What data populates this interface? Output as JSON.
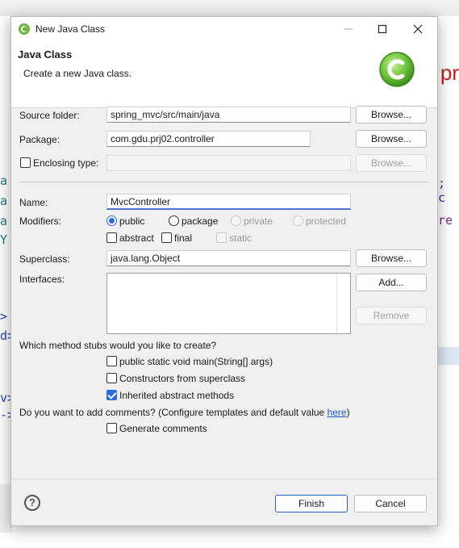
{
  "window": {
    "title": "New Java Class"
  },
  "header": {
    "title": "Java Class",
    "description": "Create a new Java class."
  },
  "form": {
    "source_folder_label": "Source folder:",
    "source_folder_value": "spring_mvc/src/main/java",
    "package_label": "Package:",
    "package_value": "com.gdu.prj02.controller",
    "enclosing_type_label": "Enclosing type:",
    "enclosing_type_value": "",
    "name_label": "Name:",
    "name_value": "MvcController",
    "modifiers_label": "Modifiers:",
    "modifiers": {
      "public": "public",
      "package": "package",
      "private": "private",
      "protected": "protected",
      "abstract": "abstract",
      "final": "final",
      "static": "static"
    },
    "superclass_label": "Superclass:",
    "superclass_value": "java.lang.Object",
    "interfaces_label": "Interfaces:",
    "stubs_question": "Which method stubs would you like to create?",
    "stub_main": "public static void main(String[] args)",
    "stub_constructors": "Constructors from superclass",
    "stub_inherited": "Inherited abstract methods",
    "comments_question_prefix": "Do you want to add comments? (Configure templates and default value ",
    "comments_question_link": "here",
    "comments_question_suffix": ")",
    "generate_comments": "Generate comments"
  },
  "buttons": {
    "browse": "Browse...",
    "add": "Add...",
    "remove": "Remove",
    "finish": "Finish",
    "cancel": "Cancel"
  },
  "state": {
    "modifier_selected": "public",
    "stub_main_checked": false,
    "stub_constructors_checked": false,
    "stub_inherited_checked": true,
    "generate_comments_checked": false,
    "enclosing_type_checked": false,
    "abstract_checked": false,
    "final_checked": false,
    "static_checked": false
  },
  "colors": {
    "accent": "#2b6bd6",
    "logo_green": "#5fb832"
  },
  "icons": {
    "title": "eclipse-spring-icon",
    "logo": "new-class-wizard-icon",
    "help": "help-icon"
  }
}
